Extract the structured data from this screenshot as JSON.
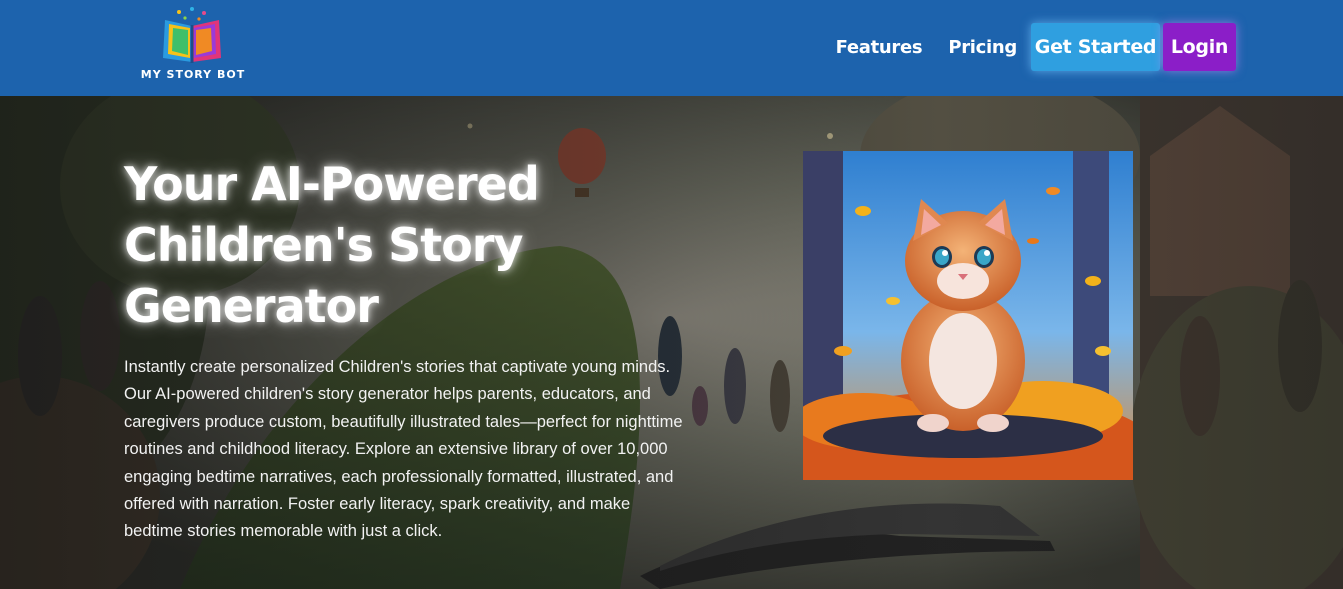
{
  "brand": {
    "name": "MY STORY BOT"
  },
  "nav": {
    "features": "Features",
    "pricing": "Pricing",
    "get_started": "Get Started",
    "login": "Login"
  },
  "hero": {
    "title_lines": [
      "Your AI-Powered",
      "Children's Story",
      "Generator"
    ],
    "description": "Instantly create personalized Children's stories that captivate young minds. Our AI-powered children's story generator helps parents, educators, and caregivers produce custom, beautifully illustrated tales—perfect for nighttime routines and childhood literacy. Explore an extensive library of over 10,000 engaging bedtime narratives, each professionally formatted, illustrated, and offered with narration. Foster early literacy, spark creativity, and make bedtime stories memorable with just a click.",
    "image_subject": "kitten-in-autumn-leaves-illustration"
  },
  "colors": {
    "navbar": "#1d63ad",
    "get_started_button": "#2f9fe0",
    "login_button": "#8b1ec8",
    "hero_text": "#ffffff"
  },
  "icons": [
    "book-logo-icon"
  ]
}
